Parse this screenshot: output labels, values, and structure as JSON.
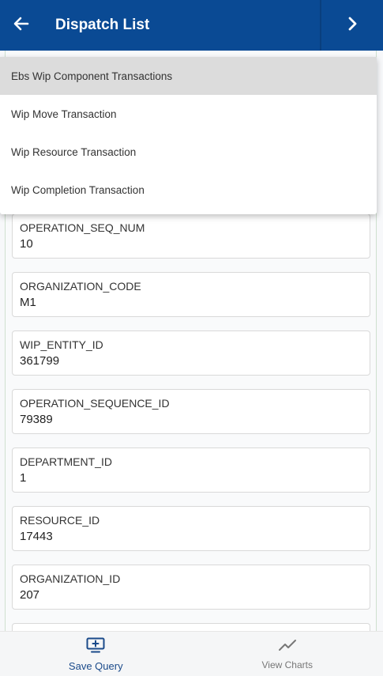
{
  "header": {
    "title": "Dispatch List",
    "back_icon": "arrow-left-icon",
    "next_icon": "chevron-right-icon",
    "background": "#0a4a94"
  },
  "dropdown": {
    "items": [
      {
        "label": "Ebs Wip Component Transactions",
        "highlighted": true
      },
      {
        "label": "Wip Move Transaction",
        "highlighted": false
      },
      {
        "label": "Wip Resource Transaction",
        "highlighted": false
      },
      {
        "label": "Wip Completion Transaction",
        "highlighted": false
      }
    ]
  },
  "fields": [
    {
      "label": "OPERATION_SEQ_NUM",
      "value": "10"
    },
    {
      "label": "ORGANIZATION_CODE",
      "value": "M1"
    },
    {
      "label": "WIP_ENTITY_ID",
      "value": "361799"
    },
    {
      "label": "OPERATION_SEQUENCE_ID",
      "value": "79389"
    },
    {
      "label": "DEPARTMENT_ID",
      "value": "1"
    },
    {
      "label": "RESOURCE_ID",
      "value": "17443"
    },
    {
      "label": "ORGANIZATION_ID",
      "value": "207"
    }
  ],
  "bottom_bar": {
    "save_query": {
      "label": "Save Query",
      "icon": "monitor-plus-icon",
      "color": "#1a4a8a"
    },
    "view_charts": {
      "label": "View Charts",
      "icon": "line-chart-icon",
      "color": "#777777"
    }
  }
}
